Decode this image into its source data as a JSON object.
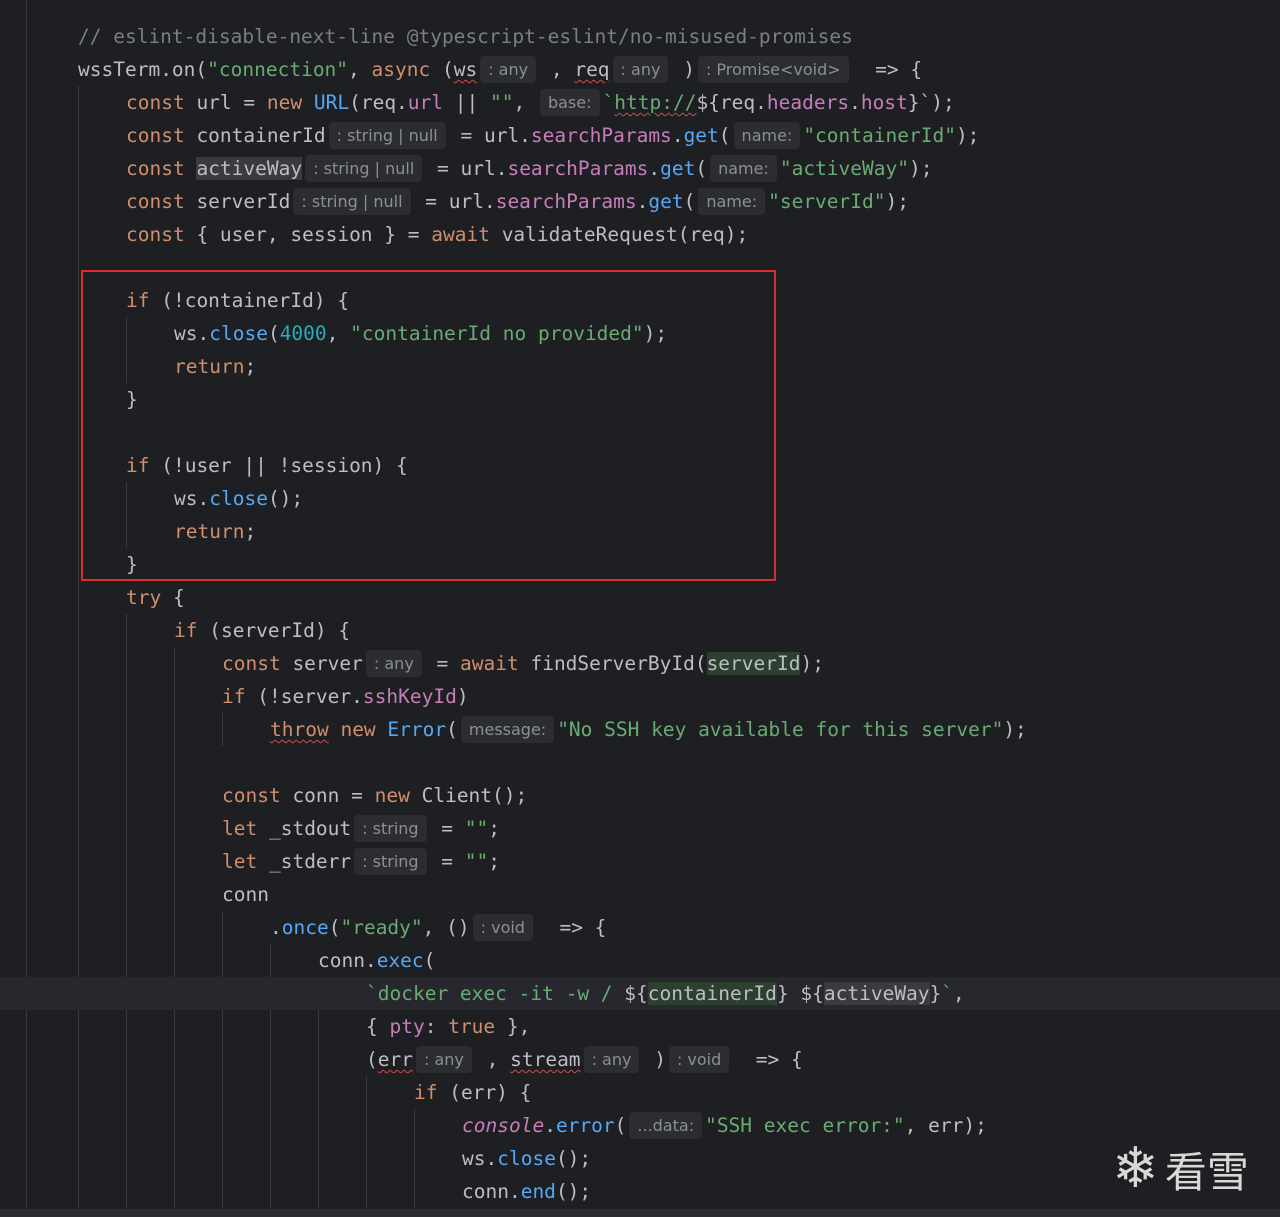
{
  "hints": {
    "any": ": any",
    "promise_void": ": Promise<void>",
    "base": "base:",
    "string_or_null": ": string | null",
    "name": "name:",
    "message": "message:",
    "string": ": string",
    "void": ": void",
    "data": "...data:"
  },
  "code": {
    "l01": "// eslint-disable-next-line @typescript-eslint/no-misused-promises",
    "l02_wss": "wssTerm",
    "l02_on": ".on(",
    "l02_str": "\"connection\"",
    "l02_async": ", async (",
    "l02_ws": "ws",
    "l02_req": "req",
    "l02_arrow": "=> {",
    "l03_const": "const",
    "l03_url": " url = ",
    "l03_new": "new",
    "l03_URL": " URL",
    "l03_mid": "(req.",
    "l03_urlprop": "url",
    "l03_or": " || ",
    "l03_empty": "\"\"",
    "l03_comma": ", ",
    "l03_tpl_open": "`",
    "l03_http": "http://",
    "l03_dollar": "${req.",
    "l03_headers": "headers",
    "l03_dot": ".",
    "l03_host": "host",
    "l03_end": "}`);",
    "l04_name": " containerId",
    "l04_pre": " = url.",
    "l04_sp": "searchParams",
    "l04_get": "get",
    "l04_str": "\"containerId\"",
    "l05_name": "activeWay",
    "l05_str": "\"activeWay\"",
    "l06_name": " serverId",
    "l06_str": "\"serverId\"",
    "l07_a": " { user, session } = ",
    "l07_await": "await",
    "l07_b": " validateRequest(req);",
    "l09_if": "if",
    "l09_rest": " (!containerId) {",
    "l10_ws": "ws.",
    "l10_close": "close",
    "l10_num": "4000",
    "l10_str": "\"containerId no provided\"",
    "return": "return",
    "close_brace": "}",
    "l14_rest": " (!user || !session) {",
    "l15_rest": "();",
    "l18_try": "try",
    "l19_rest": " (serverId) {",
    "l20_server": " server",
    "l20_find": " findServerById(",
    "l20_arg": "serverId",
    "l21_rest": " (!server.",
    "l21_key": "sshKeyId",
    "l22_throw": "throw",
    "l22_err": " Error",
    "l22_str": "\"No SSH key available for this server\"",
    "l24_conn": " conn = ",
    "l24_client": " Client();",
    "let": "let",
    "l25_name": " _stdout",
    "l26_name": " _stderr",
    "l27_conn": "conn",
    "l28_once": "once",
    "l28_str": "\"ready\"",
    "l29_conn": "conn.",
    "l29_exec": "exec",
    "l30_tpl": "`docker exec -it -w / ",
    "l30_cid": "containerId",
    "l30_aw": "activeWay",
    "l31_pty": "pty",
    "l31_true": "true",
    "l32_err": "err",
    "l32_stream": "stream",
    "l33_rest": " (err) {",
    "l34_console": "console",
    "l34_error": "error",
    "l34_str": "\"SSH exec error:\"",
    "l36_end": "end"
  },
  "watermark": {
    "text": "看雪"
  }
}
